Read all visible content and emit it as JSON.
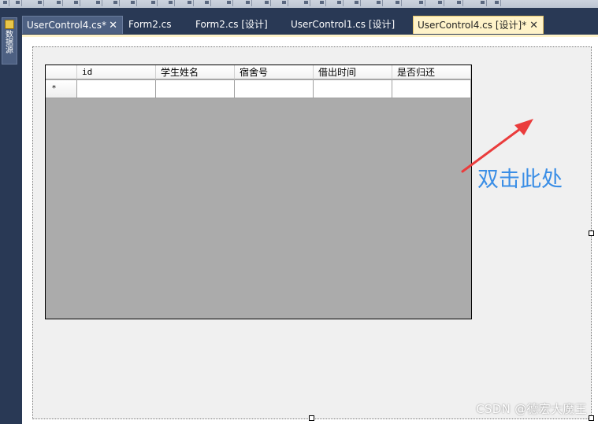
{
  "side_panel": {
    "label": "数据源"
  },
  "tabs": [
    {
      "label": "UserControl4.cs*",
      "close": "✕",
      "state": "modified"
    },
    {
      "label": "Form2.cs"
    },
    {
      "label": "Form2.cs [设计]"
    },
    {
      "label": "UserControl1.cs [设计]"
    },
    {
      "label": "UserControl4.cs [设计]*",
      "close": "✕",
      "state": "active"
    }
  ],
  "grid": {
    "columns": [
      "id",
      "学生姓名",
      "宿舍号",
      "借出时间",
      "是否归还"
    ],
    "new_row_marker": "*",
    "background": "#ababab"
  },
  "annotation": {
    "text": "双击此处",
    "color": "#3a8ee6",
    "arrow_color": "#ea3c3c"
  },
  "watermark": "CSDN @德宏大魔王"
}
